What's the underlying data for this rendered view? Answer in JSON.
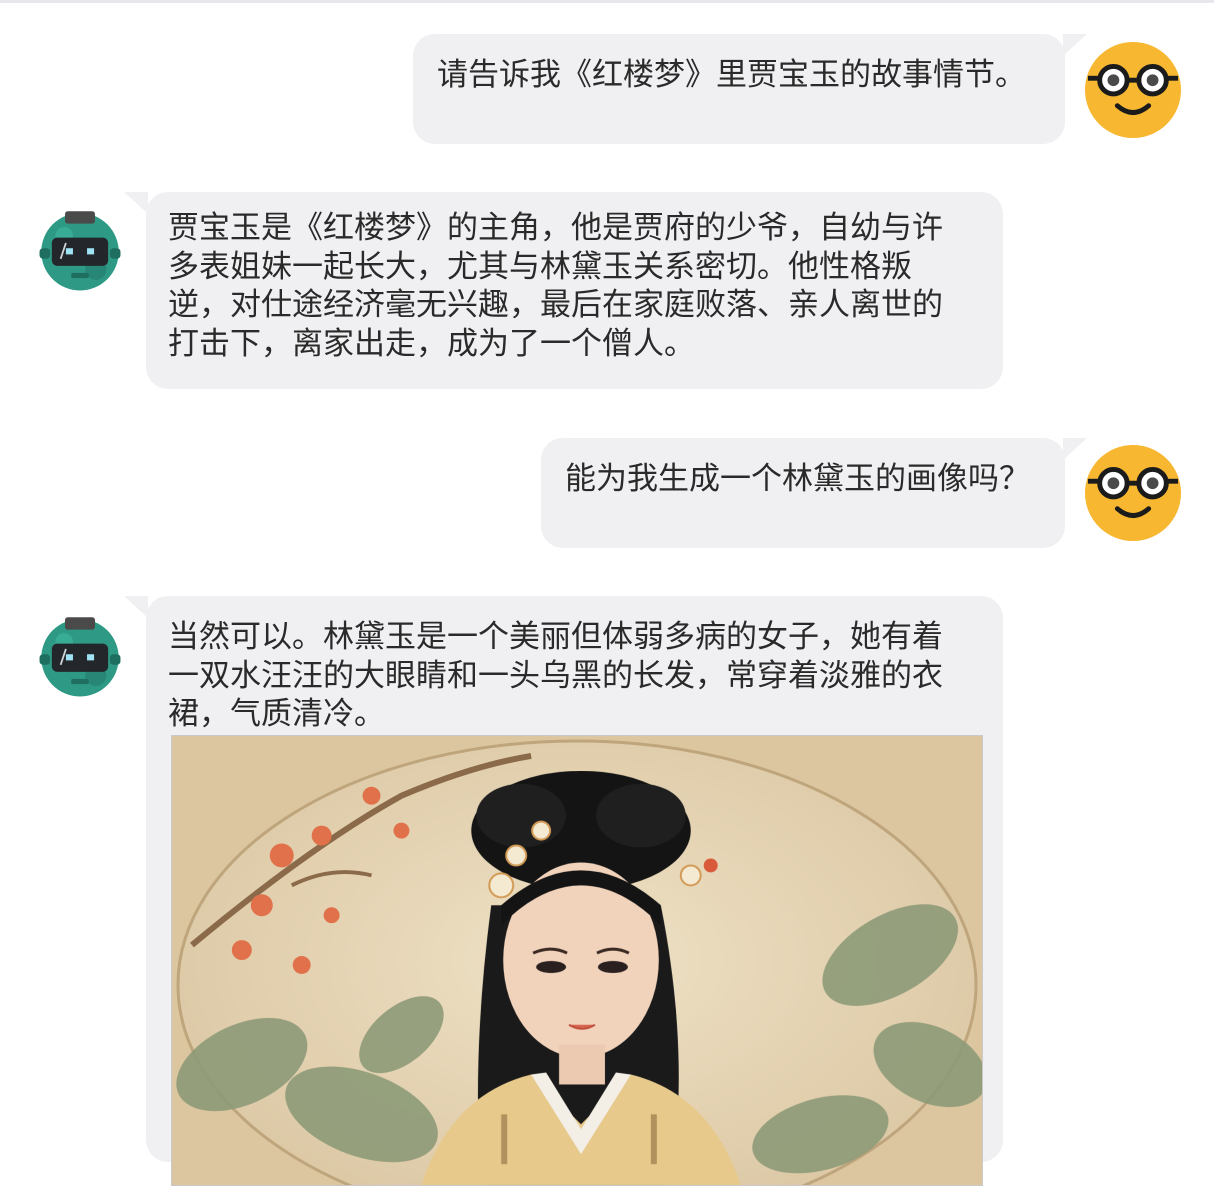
{
  "conversation": {
    "messages": [
      {
        "role": "user",
        "text": "请告诉我《红楼梦》里贾宝玉的故事情节。"
      },
      {
        "role": "assistant",
        "text": "贾宝玉是《红楼梦》的主角，他是贾府的少爷，自幼与许\n多表姐妹一起长大，尤其与林黛玉关系密切。他性格叛\n逆，对仕途经济毫无兴趣，最后在家庭败落、亲人离世的\n打击下，离家出走，成为了一个僧人。"
      },
      {
        "role": "user",
        "text": "能为我生成一个林黛玉的画像吗？"
      },
      {
        "role": "assistant",
        "text": "当然可以。林黛玉是一个美丽但体弱多病的女子，她有着\n一双水汪汪的大眼睛和一头乌黑的长发，常穿着淡雅的衣\n裙，气质清冷。"
      }
    ]
  },
  "icons": {
    "user_avatar": "nerd-glasses-smiley-icon",
    "assistant_avatar": "robot-head-icon"
  },
  "colors": {
    "bubble_background": "#f0f0f3",
    "user_avatar_yellow": "#f7b731",
    "assistant_avatar_teal": "#2e9a86",
    "text": "#2a2a2a"
  },
  "image": {
    "subject": "traditional-chinese-painting-portrait"
  }
}
